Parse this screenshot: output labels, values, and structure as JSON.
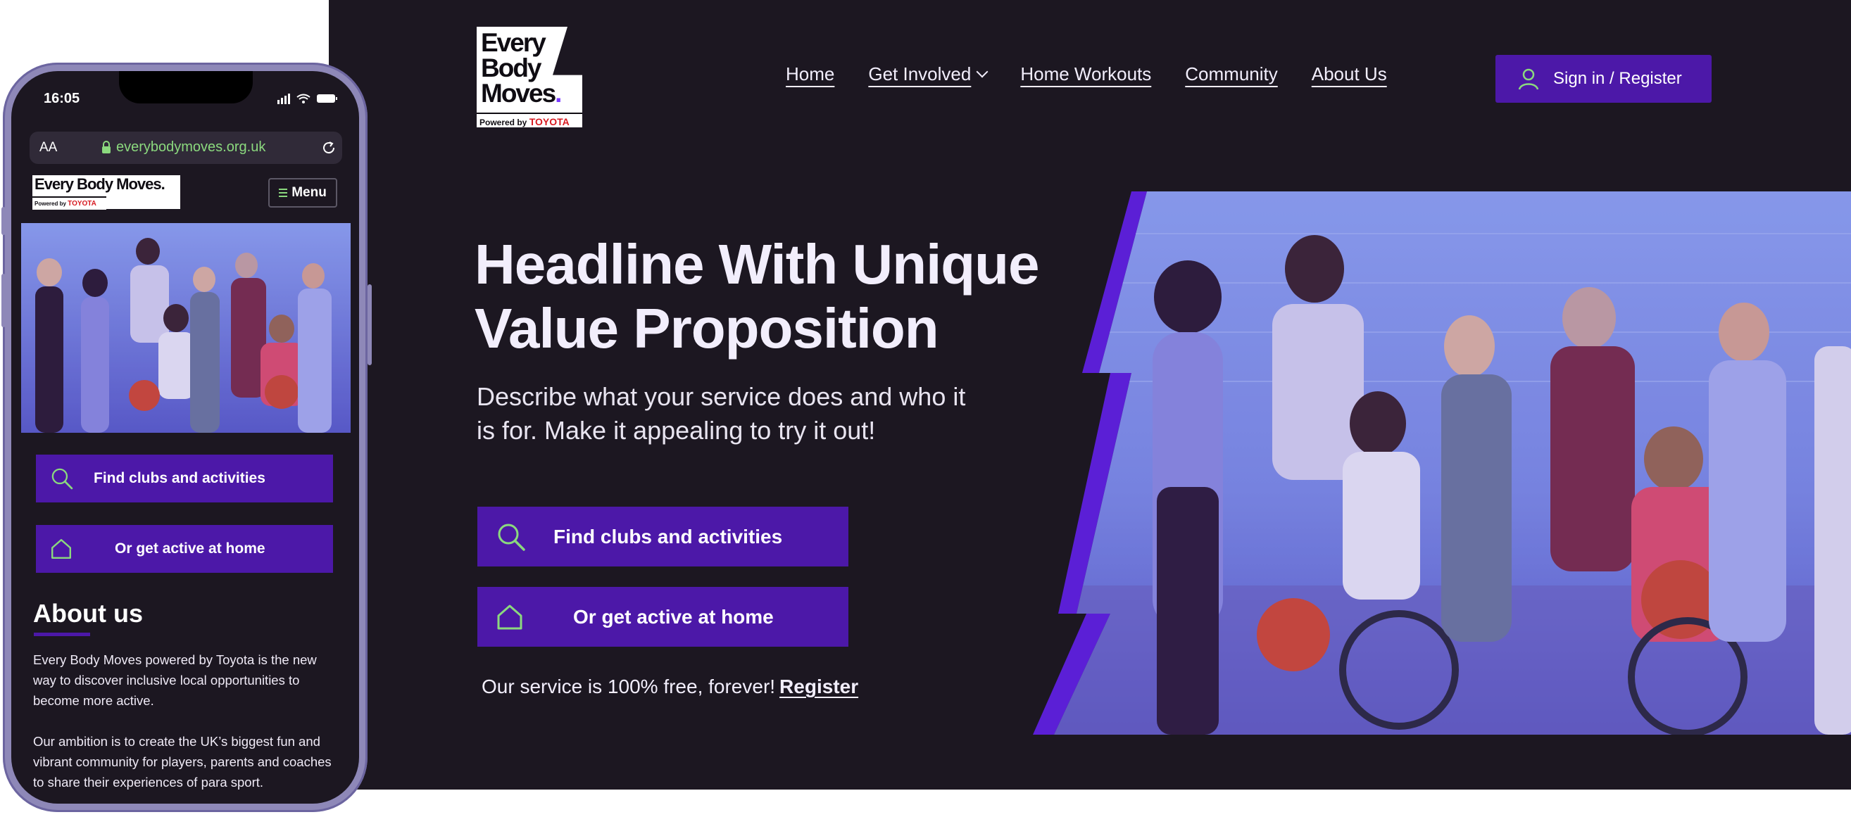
{
  "desktop": {
    "logo": {
      "line1": "Every",
      "line2": "Body",
      "line3": "Moves",
      "dot": ".",
      "powered_by": "Powered by",
      "toyota": "TOYOTA"
    },
    "nav": {
      "items": [
        {
          "label": "Home"
        },
        {
          "label": "Get Involved"
        },
        {
          "label": "Home Workouts"
        },
        {
          "label": "Community"
        },
        {
          "label": "About Us"
        }
      ]
    },
    "sign_in_label": "Sign in / Register",
    "headline": "Headline With Unique Value Proposition",
    "subheadline": "Describe what your service does and who it is for. Make it appealing to try it out!",
    "cta_primary": "Find clubs and activities",
    "cta_secondary": "Or get active at home",
    "free_text": "Our service is 100% free, forever!",
    "register_link": "Register"
  },
  "phone": {
    "time": "16:05",
    "url_text_size": "AA",
    "url": "everybodymoves.org.uk",
    "logo_text": "Every Body Moves.",
    "powered_by": "Powered by",
    "toyota": "TOYOTA",
    "menu_label": "Menu",
    "cta_primary": "Find clubs and activities",
    "cta_secondary": "Or get active at home",
    "about": {
      "title": "About us",
      "paragraph1": "Every Body Moves powered by Toyota is the new way to discover inclusive local opportunities to become more active.",
      "paragraph2": "Our ambition is to create the UK’s biggest fun and vibrant community for players, parents and coaches to share their experiences of para sport."
    }
  },
  "colors": {
    "background": "#1c1721",
    "brand_purple": "#4c18a8",
    "accent_green": "#8bd97e",
    "text_light": "#f2eefc",
    "toyota_red": "#d71a21"
  },
  "icons": {
    "search": "search-icon",
    "home": "home-icon",
    "user": "user-icon",
    "chevron": "chevron-down-icon",
    "menu": "menu-icon",
    "lock": "lock-icon",
    "reload": "reload-icon"
  }
}
